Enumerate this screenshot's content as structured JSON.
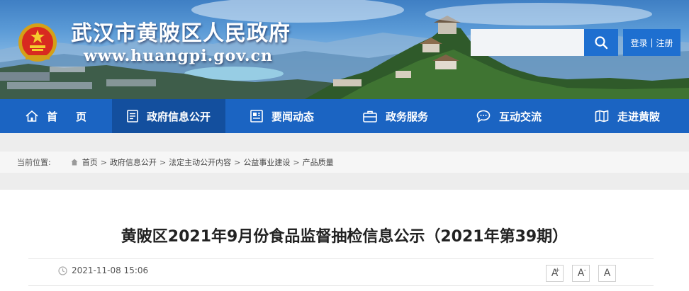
{
  "header": {
    "site_title": "武汉市黄陂区人民政府",
    "site_url": "www.huangpi.gov.cn",
    "search": {
      "placeholder": "",
      "value": ""
    },
    "login_label": "登录",
    "register_label": "注册",
    "auth_separator": "|"
  },
  "nav": {
    "items": [
      {
        "label": "首页",
        "icon": "home-icon",
        "active": false
      },
      {
        "label": "政府信息公开",
        "icon": "document-list-icon",
        "active": true
      },
      {
        "label": "要闻动态",
        "icon": "newspaper-icon",
        "active": false
      },
      {
        "label": "政务服务",
        "icon": "briefcase-icon",
        "active": false
      },
      {
        "label": "互动交流",
        "icon": "chat-bubble-icon",
        "active": false
      },
      {
        "label": "走进黄陂",
        "icon": "map-book-icon",
        "active": false
      }
    ]
  },
  "breadcrumb": {
    "label": "当前位置:",
    "separator": ">",
    "items": [
      "首页",
      "政府信息公开",
      "法定主动公开内容",
      "公益事业建设",
      "产品质量"
    ]
  },
  "article": {
    "title": "黄陂区2021年9月份食品监督抽检信息公示（2021年第39期）",
    "date": "2021-11-08 15:06",
    "font_buttons": [
      {
        "label": "A",
        "mark": "+"
      },
      {
        "label": "A",
        "mark": "-"
      },
      {
        "label": "A",
        "mark": ""
      }
    ]
  },
  "colors": {
    "nav_bg": "#1b64c2",
    "nav_active": "#134f9e",
    "search_button": "#1e6fd0",
    "page_bg": "#ededed"
  }
}
